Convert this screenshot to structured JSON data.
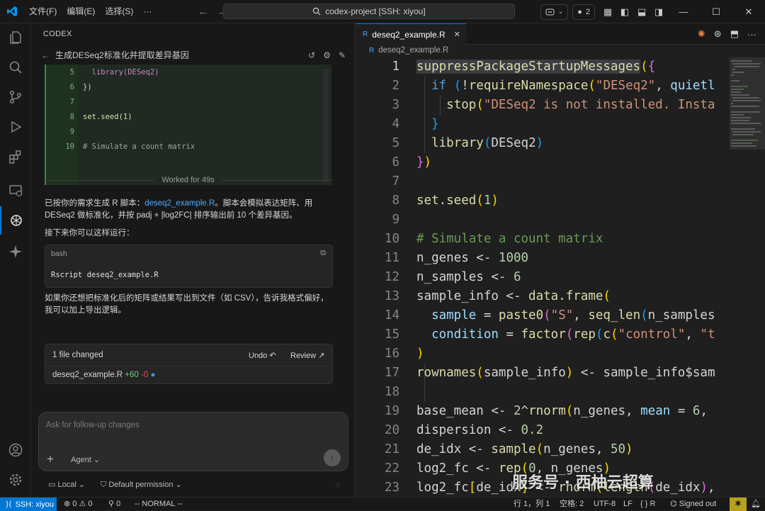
{
  "titlebar": {
    "menus": [
      "文件(F)",
      "编辑(E)",
      "选择(S)"
    ],
    "more": "···",
    "search_text": "codex-project [SSH: xiyou]",
    "badge_count": "2"
  },
  "panel": {
    "header": "CODEX",
    "task_title": "生成DESeq2标准化并提取差异基因",
    "code_lines": [
      {
        "num": "5",
        "text": "  library(DESeq2)"
      },
      {
        "num": "6",
        "text": "})"
      },
      {
        "num": "7",
        "text": ""
      },
      {
        "num": "8",
        "text": "set.seed(1)"
      },
      {
        "num": "9",
        "text": ""
      },
      {
        "num": "10",
        "text": "# Simulate a count matrix"
      }
    ],
    "worked_for": "Worked for 49s",
    "para1_a": "已按你的需求生成 R 脚本：",
    "para1_link": "deseq2_example.R",
    "para1_b": "。脚本会模拟表达矩阵、用 DESeq2 做标准化，并按 padj + |log2FC| 排序输出前 10 个差异基因。",
    "para2": "接下来你可以这样运行：",
    "bash_lang": "bash",
    "bash_cmd": "Rscript deseq2_example.R",
    "para3": "如果你还想把标准化后的矩阵或结果写出到文件（如 CSV），告诉我格式偏好，我可以加上导出逻辑。",
    "files_changed": "1 file changed",
    "undo": "Undo",
    "review": "Review",
    "file_name": "deseq2_example.R",
    "file_add": "+60",
    "file_del": "-0",
    "composer_placeholder": "Ask for follow-up changes",
    "agent_label": "Agent",
    "local_label": "Local",
    "permission_label": "Default permission"
  },
  "editor": {
    "tab_name": "deseq2_example.R",
    "breadcrumb": "deseq2_example.R"
  },
  "statusbar": {
    "remote": "SSH: xiyou",
    "errors": "0",
    "warnings": "0",
    "ports": "0",
    "mode": "-- NORMAL --",
    "position": "行 1，列 1",
    "spaces": "空格: 2",
    "encoding": "UTF-8",
    "eol": "LF",
    "language": "R",
    "account": "Signed out"
  },
  "watermark": "服务号 · 西柚云超算",
  "colors": {
    "accent": "#0078d4",
    "status_bg": "#181818",
    "editor_bg": "#1f1f1f"
  }
}
